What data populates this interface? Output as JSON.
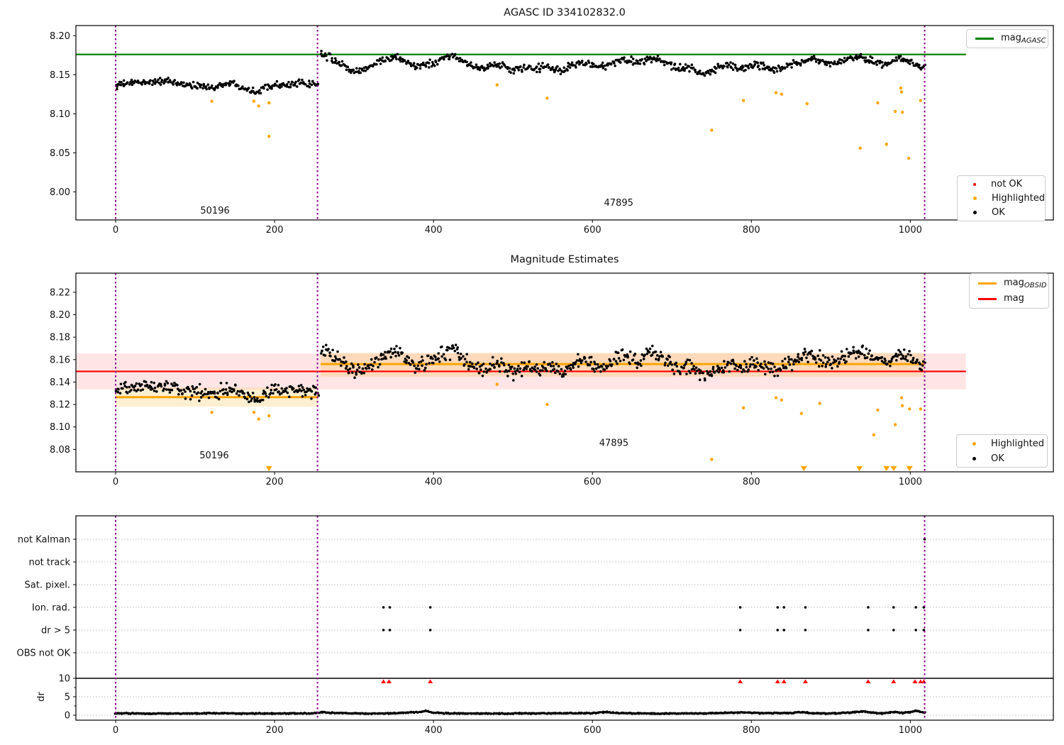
{
  "colors": {
    "ok": "#000000",
    "highlighted": "#ffa500",
    "not_ok": "#ff0000",
    "mag_agasc": "#008000",
    "mag_obsid": "#ffa500",
    "mag": "#ff0000",
    "vline": "#8b008b",
    "grid": "#bbbbbb",
    "frame": "#000000",
    "band_red": "rgba(255,0,0,0.10)",
    "band_orange": "rgba(255,166,0,0.18)"
  },
  "chart_data": [
    {
      "type": "scatter",
      "title": "AGASC ID 334102832.0",
      "xlim": [
        -50,
        1180
      ],
      "ylim": [
        7.964,
        8.213
      ],
      "xtick_values": [
        0,
        200,
        400,
        600,
        800,
        1000
      ],
      "xtick_labels": [
        "0",
        "200",
        "400",
        "600",
        "800",
        "1000"
      ],
      "ytick_values": [
        8.0,
        8.05,
        8.1,
        8.15,
        8.2
      ],
      "ytick_labels": [
        "8.00",
        "8.05",
        "8.10",
        "8.15",
        "8.20"
      ],
      "vlines": [
        0,
        254,
        1018
      ],
      "hlines": [
        {
          "name": "mag_agasc",
          "y": 8.176,
          "x0": -50,
          "x1": 1070,
          "color_key": "mag_agasc",
          "width": 2.2
        }
      ],
      "legend_line": {
        "items": [
          {
            "text": "mag",
            "sub": "AGASC"
          }
        ]
      },
      "legend_points": {
        "items": [
          {
            "label": "not OK",
            "color_key": "not_ok"
          },
          {
            "label": "Highlighted",
            "color_key": "highlighted"
          },
          {
            "label": "OK",
            "color_key": "ok"
          }
        ]
      },
      "annotations": [
        {
          "text": "50196",
          "x": 125,
          "y": 7.972
        },
        {
          "text": "47895",
          "x": 633,
          "y": 7.982
        }
      ],
      "ok_series": {
        "segments": [
          {
            "n": 230,
            "noise": 0.004,
            "anchors": [
              [
                0,
                8.136
              ],
              [
                15,
                8.139
              ],
              [
                30,
                8.14
              ],
              [
                45,
                8.141
              ],
              [
                60,
                8.142
              ],
              [
                75,
                8.139
              ],
              [
                90,
                8.137
              ],
              [
                105,
                8.136
              ],
              [
                120,
                8.133
              ],
              [
                135,
                8.138
              ],
              [
                150,
                8.139
              ],
              [
                160,
                8.134
              ],
              [
                170,
                8.13
              ],
              [
                180,
                8.129
              ],
              [
                190,
                8.135
              ],
              [
                200,
                8.138
              ],
              [
                215,
                8.137
              ],
              [
                230,
                8.139
              ],
              [
                245,
                8.138
              ],
              [
                255,
                8.136
              ]
            ]
          },
          {
            "n": 690,
            "noise": 0.0045,
            "anchors": [
              [
                258,
                8.177
              ],
              [
                265,
                8.174
              ],
              [
                275,
                8.168
              ],
              [
                285,
                8.163
              ],
              [
                295,
                8.157
              ],
              [
                305,
                8.155
              ],
              [
                315,
                8.16
              ],
              [
                325,
                8.163
              ],
              [
                335,
                8.168
              ],
              [
                345,
                8.172
              ],
              [
                352,
                8.174
              ],
              [
                360,
                8.169
              ],
              [
                370,
                8.164
              ],
              [
                380,
                8.16
              ],
              [
                390,
                8.163
              ],
              [
                400,
                8.166
              ],
              [
                410,
                8.17
              ],
              [
                418,
                8.174
              ],
              [
                425,
                8.175
              ],
              [
                432,
                8.171
              ],
              [
                440,
                8.166
              ],
              [
                450,
                8.16
              ],
              [
                460,
                8.158
              ],
              [
                470,
                8.161
              ],
              [
                480,
                8.163
              ],
              [
                490,
                8.16
              ],
              [
                500,
                8.156
              ],
              [
                510,
                8.158
              ],
              [
                520,
                8.16
              ],
              [
                530,
                8.158
              ],
              [
                540,
                8.161
              ],
              [
                550,
                8.158
              ],
              [
                560,
                8.155
              ],
              [
                570,
                8.16
              ],
              [
                580,
                8.164
              ],
              [
                590,
                8.166
              ],
              [
                600,
                8.162
              ],
              [
                610,
                8.16
              ],
              [
                620,
                8.163
              ],
              [
                630,
                8.166
              ],
              [
                640,
                8.169
              ],
              [
                650,
                8.167
              ],
              [
                660,
                8.165
              ],
              [
                670,
                8.17
              ],
              [
                680,
                8.172
              ],
              [
                690,
                8.167
              ],
              [
                700,
                8.16
              ],
              [
                710,
                8.158
              ],
              [
                720,
                8.16
              ],
              [
                730,
                8.156
              ],
              [
                740,
                8.152
              ],
              [
                750,
                8.155
              ],
              [
                760,
                8.159
              ],
              [
                770,
                8.162
              ],
              [
                780,
                8.16
              ],
              [
                790,
                8.158
              ],
              [
                800,
                8.163
              ],
              [
                810,
                8.162
              ],
              [
                820,
                8.158
              ],
              [
                830,
                8.156
              ],
              [
                840,
                8.16
              ],
              [
                850,
                8.163
              ],
              [
                860,
                8.166
              ],
              [
                870,
                8.169
              ],
              [
                880,
                8.171
              ],
              [
                890,
                8.166
              ],
              [
                900,
                8.163
              ],
              [
                910,
                8.166
              ],
              [
                920,
                8.17
              ],
              [
                930,
                8.172
              ],
              [
                940,
                8.173
              ],
              [
                950,
                8.169
              ],
              [
                960,
                8.166
              ],
              [
                970,
                8.164
              ],
              [
                980,
                8.168
              ],
              [
                990,
                8.171
              ],
              [
                1000,
                8.166
              ],
              [
                1008,
                8.162
              ],
              [
                1014,
                8.16
              ],
              [
                1018,
                8.162
              ]
            ]
          }
        ]
      },
      "highlighted_points": [
        [
          121,
          8.116
        ],
        [
          174,
          8.116
        ],
        [
          180,
          8.11
        ],
        [
          193,
          8.114
        ],
        [
          193,
          8.071
        ],
        [
          480,
          8.137
        ],
        [
          543,
          8.12
        ],
        [
          750,
          8.079
        ],
        [
          790,
          8.117
        ],
        [
          831,
          8.127
        ],
        [
          838,
          8.125
        ],
        [
          870,
          8.113
        ],
        [
          937,
          8.056
        ],
        [
          959,
          8.114
        ],
        [
          970,
          8.061
        ],
        [
          981,
          8.103
        ],
        [
          988,
          8.133
        ],
        [
          989,
          8.128
        ],
        [
          990,
          8.102
        ],
        [
          998,
          8.043
        ],
        [
          1013,
          8.117
        ]
      ]
    },
    {
      "type": "scatter",
      "title": "Magnitude Estimates",
      "xlim": [
        -50,
        1180
      ],
      "ylim": [
        8.06,
        8.237
      ],
      "xtick_values": [
        0,
        200,
        400,
        600,
        800,
        1000
      ],
      "xtick_labels": [
        "0",
        "200",
        "400",
        "600",
        "800",
        "1000"
      ],
      "ytick_values": [
        8.08,
        8.1,
        8.12,
        8.14,
        8.16,
        8.18,
        8.2,
        8.22
      ],
      "ytick_labels": [
        "8.08",
        "8.10",
        "8.12",
        "8.14",
        "8.16",
        "8.18",
        "8.20",
        "8.22"
      ],
      "vlines": [
        0,
        254,
        1018
      ],
      "bands": [
        {
          "y0": 8.1335,
          "y1": 8.1655,
          "x0": -50,
          "x1": 1070,
          "fill_key": "band_red"
        },
        {
          "y0": 8.118,
          "y1": 8.135,
          "x0": 0,
          "x1": 255,
          "fill_key": "band_orange"
        },
        {
          "y0": 8.145,
          "y1": 8.166,
          "x0": 258,
          "x1": 1018,
          "fill_key": "band_orange"
        }
      ],
      "hlines": [
        {
          "name": "mag",
          "y": 8.1495,
          "x0": -50,
          "x1": 1070,
          "color_key": "mag",
          "width": 2.2
        },
        {
          "name": "mag_obsid_1",
          "y": 8.1265,
          "x0": 0,
          "x1": 255,
          "color_key": "mag_obsid",
          "width": 3
        },
        {
          "name": "mag_obsid_2",
          "y": 8.156,
          "x0": 258,
          "x1": 1018,
          "color_key": "mag_obsid",
          "width": 3
        }
      ],
      "legend_line": {
        "items": [
          {
            "text": "mag",
            "sub": "OBSID"
          },
          {
            "text": "mag",
            "sub": ""
          }
        ]
      },
      "legend_points": {
        "items": [
          {
            "label": "Highlighted",
            "color_key": "highlighted"
          },
          {
            "label": "OK",
            "color_key": "ok"
          }
        ]
      },
      "annotations": [
        {
          "text": "50196",
          "x": 124,
          "y": 8.072
        },
        {
          "text": "47895",
          "x": 627,
          "y": 8.083
        }
      ],
      "ok_series": {
        "segments": [
          {
            "n": 230,
            "noise": 0.006,
            "anchor_ref": [
              0,
              0
            ],
            "offset": -0.005
          },
          {
            "n": 690,
            "noise": 0.0065,
            "anchor_ref": [
              0,
              1
            ],
            "offset": -0.006
          }
        ]
      },
      "highlighted_points": [
        [
          121,
          8.113
        ],
        [
          174,
          8.113
        ],
        [
          180,
          8.107
        ],
        [
          193,
          8.11
        ],
        [
          480,
          8.138
        ],
        [
          543,
          8.12
        ],
        [
          750,
          8.071
        ],
        [
          790,
          8.117
        ],
        [
          831,
          8.126
        ],
        [
          838,
          8.124
        ],
        [
          863,
          8.112
        ],
        [
          886,
          8.121
        ],
        [
          954,
          8.093
        ],
        [
          959,
          8.115
        ],
        [
          981,
          8.102
        ],
        [
          989,
          8.126
        ],
        [
          990,
          8.119
        ],
        [
          999,
          8.116
        ],
        [
          1013,
          8.116
        ]
      ],
      "clipped_low_x": [
        193,
        866,
        936,
        970,
        979,
        999
      ]
    },
    {
      "type": "flags_line",
      "rows": [
        "not Kalman",
        "not track",
        "Sat. pixel.",
        "Ion. rad.",
        "dr > 5",
        "OBS not OK"
      ],
      "ylabel": "dr",
      "dr_tick_values": [
        10,
        5,
        0
      ],
      "dr_tick_labels": [
        "10",
        "5",
        "0"
      ],
      "xlim": [
        -50,
        1180
      ],
      "xtick_values": [
        0,
        200,
        400,
        600,
        800,
        1000
      ],
      "xtick_labels": [
        "0",
        "200",
        "400",
        "600",
        "800",
        "1000"
      ],
      "vlines": [
        0,
        254,
        1018
      ],
      "threshold_line_y": 10,
      "flag_points": {
        "not Kalman": [
          1018
        ],
        "not track": [],
        "Sat. pixel.": [],
        "Ion. rad.": [
          337,
          345,
          396,
          786,
          833,
          841,
          868,
          947,
          979,
          1007,
          1017
        ],
        "dr > 5": [
          337,
          345,
          396,
          786,
          833,
          841,
          868,
          947,
          979,
          1007,
          1017
        ],
        "OBS not OK": []
      },
      "exceed_points_x": [
        337,
        344,
        396,
        786,
        833,
        841,
        868,
        947,
        979,
        1006,
        1013,
        1017
      ],
      "dr_series": {
        "n": 880,
        "noise": 0.13,
        "anchors": [
          [
            0,
            0.5
          ],
          [
            60,
            0.45
          ],
          [
            120,
            0.5
          ],
          [
            180,
            0.45
          ],
          [
            240,
            0.5
          ],
          [
            253,
            0.6
          ],
          [
            258,
            0.85
          ],
          [
            268,
            0.65
          ],
          [
            300,
            0.5
          ],
          [
            340,
            0.45
          ],
          [
            385,
            0.9
          ],
          [
            392,
            1.2
          ],
          [
            398,
            0.7
          ],
          [
            420,
            0.5
          ],
          [
            480,
            0.45
          ],
          [
            540,
            0.5
          ],
          [
            600,
            0.55
          ],
          [
            620,
            0.9
          ],
          [
            628,
            0.6
          ],
          [
            680,
            0.45
          ],
          [
            740,
            0.5
          ],
          [
            790,
            0.75
          ],
          [
            810,
            0.55
          ],
          [
            850,
            0.6
          ],
          [
            862,
            0.85
          ],
          [
            880,
            0.5
          ],
          [
            910,
            0.5
          ],
          [
            940,
            1.0
          ],
          [
            950,
            0.7
          ],
          [
            965,
            0.5
          ],
          [
            980,
            0.9
          ],
          [
            990,
            0.6
          ],
          [
            1000,
            0.8
          ],
          [
            1008,
            1.3
          ],
          [
            1013,
            0.9
          ],
          [
            1018,
            0.7
          ]
        ]
      }
    }
  ]
}
